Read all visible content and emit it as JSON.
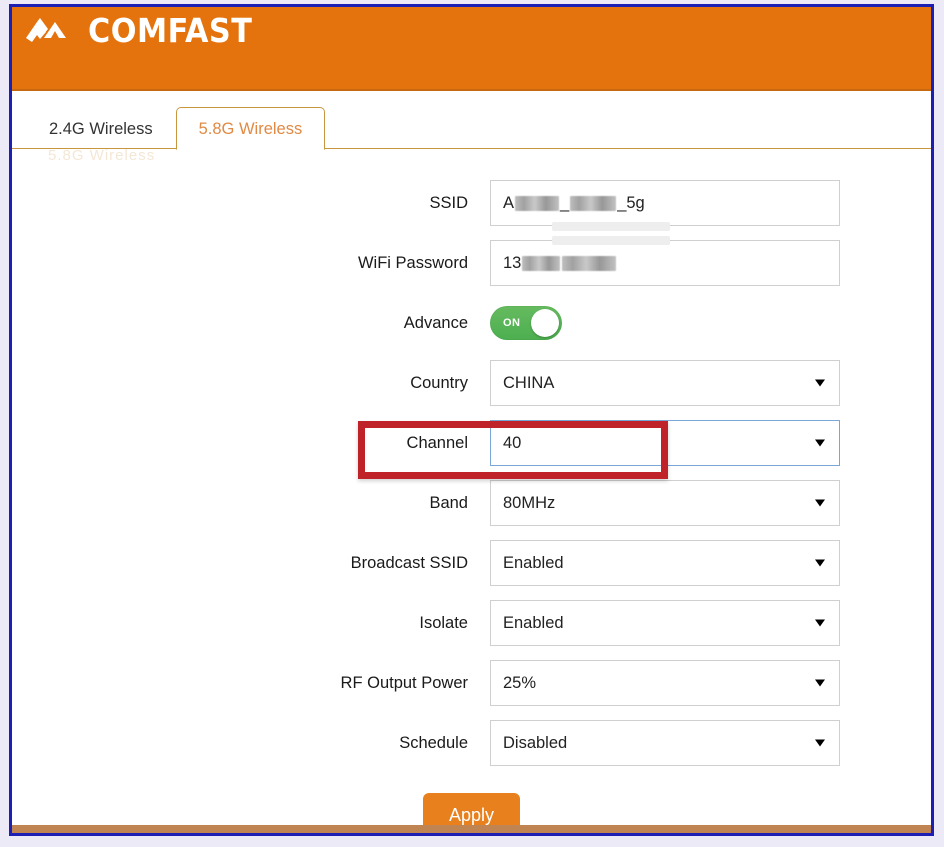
{
  "brand": {
    "logo_text": "COMFAST",
    "logo_icon": "comfast-chevron-logo-icon",
    "header_color": "#e4720d"
  },
  "tabs": [
    {
      "label": "2.4G Wireless",
      "active": false
    },
    {
      "label": "5.8G Wireless",
      "active": true
    }
  ],
  "ghost_artifact": "5.8G Wireless",
  "form": {
    "ssid": {
      "label": "SSID",
      "value_prefix": "A",
      "value_suffix": "_5g",
      "redacted": true
    },
    "wifi_password": {
      "label": "WiFi Password",
      "value_prefix": "13",
      "redacted": true
    },
    "advance": {
      "label": "Advance",
      "toggle_state": "ON",
      "on_color": "#5cb85c"
    },
    "country": {
      "label": "Country",
      "value": "CHINA"
    },
    "channel": {
      "label": "Channel",
      "value": "40",
      "focused": true,
      "highlighted": true,
      "highlight_color": "#c0222a"
    },
    "band": {
      "label": "Band",
      "value": "80MHz"
    },
    "broadcast_ssid": {
      "label": "Broadcast SSID",
      "value": "Enabled"
    },
    "isolate": {
      "label": "Isolate",
      "value": "Enabled"
    },
    "rf_output_power": {
      "label": "RF Output Power",
      "value": "25%"
    },
    "schedule": {
      "label": "Schedule",
      "value": "Disabled"
    }
  },
  "actions": {
    "apply_label": "Apply"
  },
  "icons": {
    "dropdown_caret": "chevron-down-icon"
  },
  "colors": {
    "accent_orange": "#e8801d",
    "tab_border": "#c8963e",
    "page_border": "#1d1fb4",
    "annotation_red": "#c0222a",
    "bottom_bar": "#c08452"
  }
}
